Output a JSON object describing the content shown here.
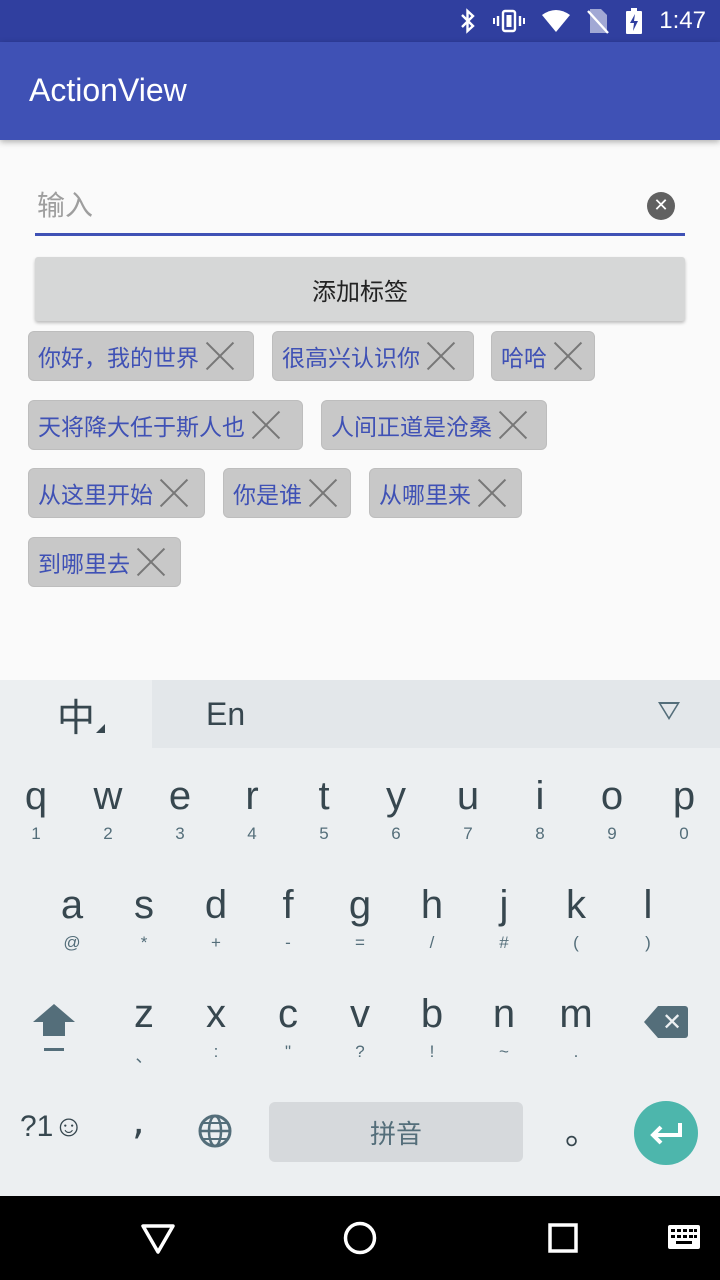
{
  "status_bar": {
    "time": "1:47"
  },
  "app_bar": {
    "title": "ActionView"
  },
  "input": {
    "placeholder": "输入",
    "value": ""
  },
  "add_button": {
    "label": "添加标签"
  },
  "tags": [
    {
      "label": "你好，我的世界"
    },
    {
      "label": "很高兴认识你"
    },
    {
      "label": "哈哈"
    },
    {
      "label": "天将降大任于斯人也"
    },
    {
      "label": "人间正道是沧桑"
    },
    {
      "label": "从这里开始"
    },
    {
      "label": "你是谁"
    },
    {
      "label": "从哪里来"
    },
    {
      "label": "到哪里去"
    }
  ],
  "keyboard": {
    "tab_zh": "中",
    "tab_en": "En",
    "row1": [
      {
        "key": "q",
        "sub": "1"
      },
      {
        "key": "w",
        "sub": "2"
      },
      {
        "key": "e",
        "sub": "3"
      },
      {
        "key": "r",
        "sub": "4"
      },
      {
        "key": "t",
        "sub": "5"
      },
      {
        "key": "y",
        "sub": "6"
      },
      {
        "key": "u",
        "sub": "7"
      },
      {
        "key": "i",
        "sub": "8"
      },
      {
        "key": "o",
        "sub": "9"
      },
      {
        "key": "p",
        "sub": "0"
      }
    ],
    "row2": [
      {
        "key": "a",
        "sub": "@"
      },
      {
        "key": "s",
        "sub": "*"
      },
      {
        "key": "d",
        "sub": "+"
      },
      {
        "key": "f",
        "sub": "-"
      },
      {
        "key": "g",
        "sub": "="
      },
      {
        "key": "h",
        "sub": "/"
      },
      {
        "key": "j",
        "sub": "#"
      },
      {
        "key": "k",
        "sub": "("
      },
      {
        "key": "l",
        "sub": ")"
      }
    ],
    "row3": [
      {
        "key": "z",
        "sub": "、"
      },
      {
        "key": "x",
        "sub": ":"
      },
      {
        "key": "c",
        "sub": "\""
      },
      {
        "key": "v",
        "sub": "?"
      },
      {
        "key": "b",
        "sub": "!"
      },
      {
        "key": "n",
        "sub": "~"
      },
      {
        "key": "m",
        "sub": "."
      }
    ],
    "symbols_label": "?1☺",
    "comma_label": ",",
    "space_label": "拼音",
    "period_label": "。"
  },
  "colors": {
    "primary_dark": "#303f9f",
    "primary": "#3f51b5",
    "accent": "#4db6ac"
  },
  "icons": [
    "bluetooth-icon",
    "vibrate-icon",
    "wifi-icon",
    "no-sim-icon",
    "battery-charging-icon",
    "clear-icon",
    "close-icon",
    "globe-icon",
    "shift-icon",
    "backspace-icon",
    "enter-icon",
    "back-icon",
    "home-icon",
    "recents-icon",
    "keyboard-icon"
  ]
}
